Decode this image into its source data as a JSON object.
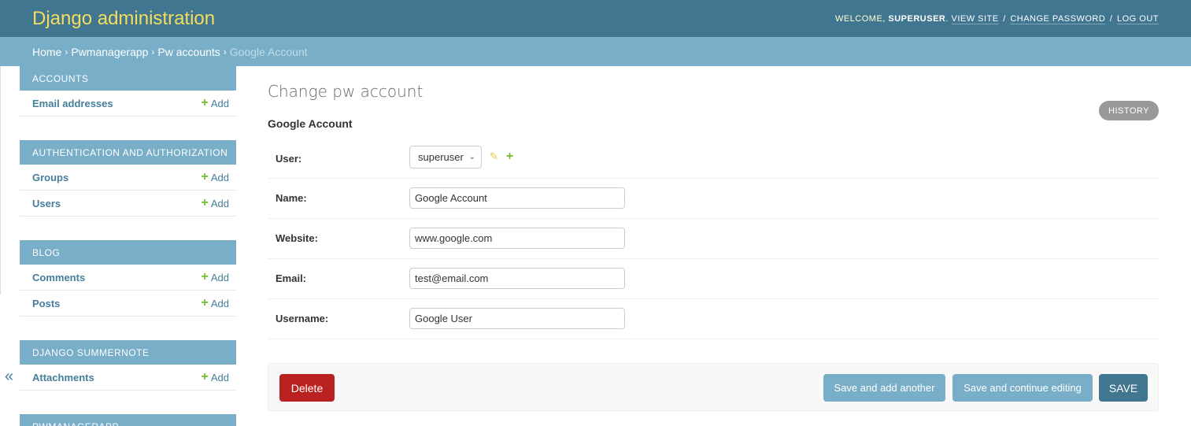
{
  "header": {
    "branding": "Django administration",
    "welcome": "Welcome,",
    "username": "superuser",
    "view_site": "View site",
    "change_password": "Change password",
    "log_out": "Log out",
    "sep": "/"
  },
  "breadcrumbs": {
    "items": [
      "Home",
      "Pwmanagerapp",
      "Pw accounts"
    ],
    "current": "Google Account",
    "sep": "›"
  },
  "sidebar": {
    "collapse_glyph": "«",
    "add_label": "Add",
    "modules": [
      {
        "caption": "Accounts",
        "models": [
          "Email addresses"
        ]
      },
      {
        "caption": "Authentication and Authorization",
        "models": [
          "Groups",
          "Users"
        ]
      },
      {
        "caption": "Blog",
        "models": [
          "Comments",
          "Posts"
        ]
      },
      {
        "caption": "Django Summernote",
        "models": [
          "Attachments"
        ]
      },
      {
        "caption": "Pwmanagerapp",
        "models": []
      }
    ]
  },
  "content": {
    "title": "Change pw account",
    "object_name": "Google Account",
    "history_label": "History",
    "fields": {
      "user": {
        "label": "User:",
        "value": "superuser"
      },
      "name": {
        "label": "Name:",
        "value": "Google Account"
      },
      "website": {
        "label": "Website:",
        "value": "www.google.com"
      },
      "email": {
        "label": "Email:",
        "value": "test@email.com"
      },
      "username": {
        "label": "Username:",
        "value": "Google User"
      }
    },
    "buttons": {
      "delete": "Delete",
      "save_add_another": "Save and add another",
      "save_continue": "Save and continue editing",
      "save": "SAVE"
    }
  },
  "icons": {
    "plus": "plus-icon",
    "pencil": "pencil-icon",
    "chevron": "chevron-down-icon",
    "collapse": "collapse-icon"
  },
  "colors": {
    "header_bg": "#417690",
    "branding": "#f5dd5d",
    "breadcrumbs_bg": "#79aec8",
    "link": "#447e9b",
    "add_plus": "#70bf2b",
    "delete": "#ba2121",
    "save": "#417690"
  }
}
